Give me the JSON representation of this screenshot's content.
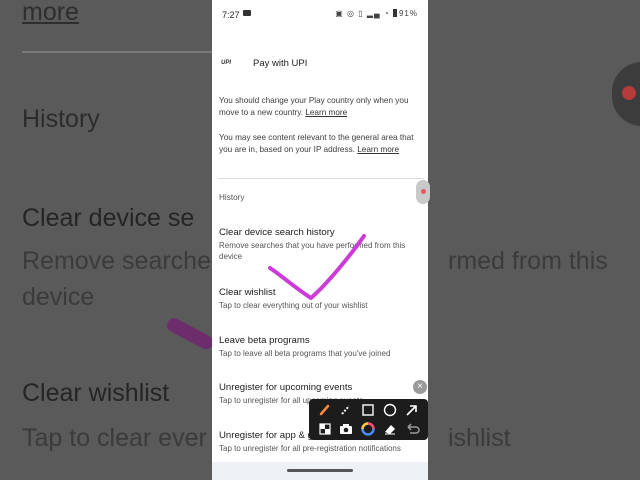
{
  "status_bar": {
    "time": "7:27",
    "battery": "91%"
  },
  "background_zoom": {
    "more": "more",
    "history": "History",
    "clear_search": "Clear device se",
    "remove_searches": "Remove searches",
    "device": "device",
    "clear_wishlist": "Clear wishlist",
    "tap_to_clear": "Tap to clear ever",
    "right_rmed": "rmed from this",
    "right_wishlist": "ishlist"
  },
  "payment": {
    "logo_text": "UPI",
    "label": "Pay with UPI"
  },
  "notices": [
    {
      "text": "You should change your Play country only when you move to a new country. ",
      "link": "Learn more"
    },
    {
      "text": "You may see content relevant to the general area that you are in, based on your IP address. ",
      "link": "Learn more"
    }
  ],
  "history_section": {
    "heading": "History",
    "items": [
      {
        "title": "Clear device search history",
        "subtitle": "Remove searches that you have performed from this device"
      },
      {
        "title": "Clear wishlist",
        "subtitle": "Tap to clear everything out of your wishlist"
      },
      {
        "title": "Leave beta programs",
        "subtitle": "Tap to leave all beta programs that you've joined"
      },
      {
        "title": "Unregister for upcoming events",
        "subtitle": "Tap to unregister for all upcoming events"
      },
      {
        "title": "Unregister for app & game pre-registration",
        "subtitle": "Tap to unregister for all pre-registration notifications"
      }
    ]
  },
  "annotation_toolbar": {
    "close_symbol": "×",
    "tools": [
      "pen-tool",
      "highlighter-tool",
      "rectangle-tool",
      "circle-tool",
      "arrow-tool",
      "mosaic-tool",
      "screenshot-tool",
      "color-picker",
      "eraser-tool",
      "undo-tool"
    ]
  },
  "colors": {
    "annotation_stroke": "#cc3bd8",
    "toolbar_bg": "#1c1c1c",
    "pen_accent": "#ff8a3d"
  }
}
